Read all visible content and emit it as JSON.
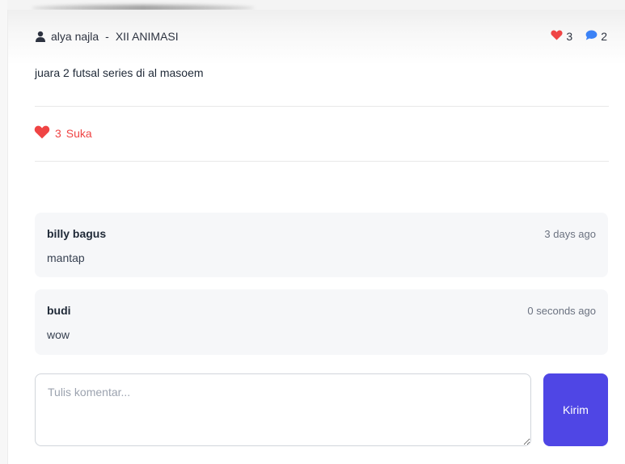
{
  "post": {
    "author": "alya najla",
    "separator": "-",
    "class": "XII ANIMASI",
    "like_count": "3",
    "comment_count": "2",
    "content": "juara 2 futsal series di al masoem"
  },
  "like_button": {
    "count": "3",
    "label": "Suka"
  },
  "comments": [
    {
      "name": "billy bagus",
      "time": "3 days ago",
      "text": "mantap"
    },
    {
      "name": "budi",
      "time": "0 seconds ago",
      "text": "wow"
    }
  ],
  "comment_form": {
    "placeholder": "Tulis komentar...",
    "value": "",
    "submit_label": "Kirim"
  },
  "colors": {
    "heart": "#ef4444",
    "comment_bubble": "#3b82f6",
    "primary": "#4f46e5"
  }
}
